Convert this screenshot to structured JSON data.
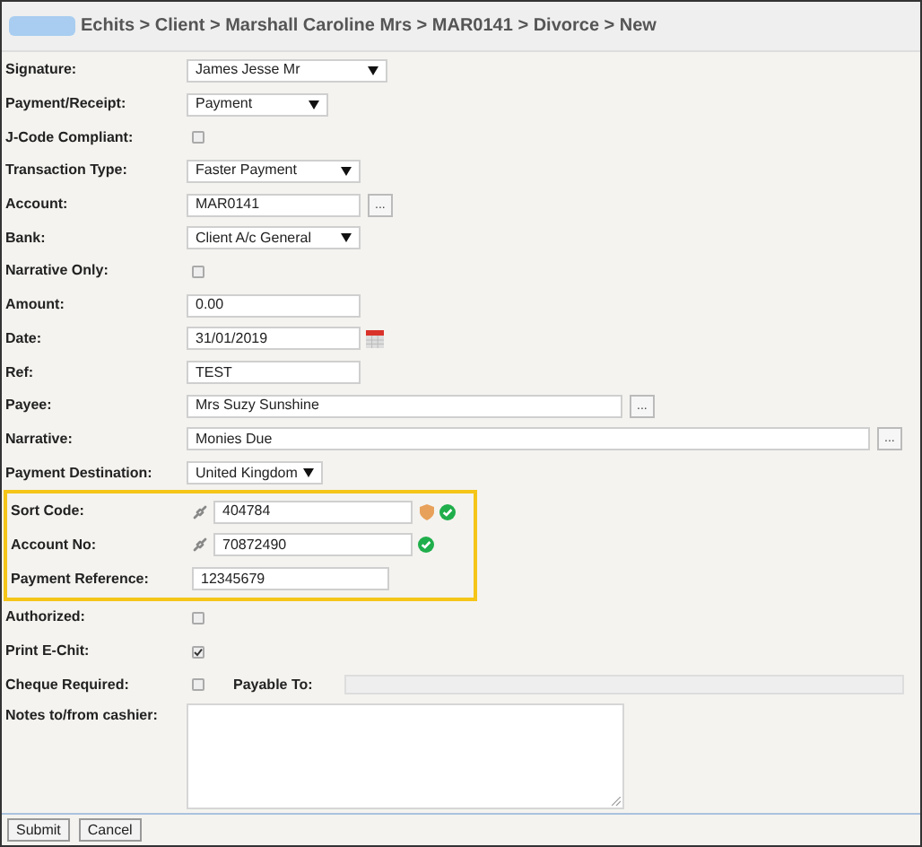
{
  "breadcrumb": "Echits > Client > Marshall Caroline Mrs > MAR0141 > Divorce > New",
  "fields": [
    {
      "label": "Signature:",
      "kind": "select",
      "value": "James Jesse Mr"
    },
    {
      "label": "Payment/Receipt:",
      "kind": "select",
      "value": "Payment"
    },
    {
      "label": "J-Code Compliant:",
      "kind": "checkbox",
      "checked": false
    },
    {
      "label": "Transaction Type:",
      "kind": "select",
      "value": "Faster Payment"
    },
    {
      "label": "Account:",
      "kind": "lookup",
      "value": "MAR0141",
      "button": "..."
    },
    {
      "label": "Bank:",
      "kind": "select",
      "value": "Client A/c General"
    },
    {
      "label": "Narrative Only:",
      "kind": "checkbox",
      "checked": false
    },
    {
      "label": "Amount:",
      "kind": "text",
      "value": "0.00"
    },
    {
      "label": "Date:",
      "kind": "date",
      "value": "31/01/2019"
    },
    {
      "label": "Ref:",
      "kind": "text",
      "value": "TEST"
    },
    {
      "label": "Payee:",
      "kind": "lookup",
      "value": "Mrs Suzy Sunshine",
      "button": "..."
    },
    {
      "label": "Narrative:",
      "kind": "lookup",
      "value": "Monies Due",
      "button": "..."
    },
    {
      "label": "Payment Destination:",
      "kind": "select",
      "value": "United Kingdom"
    }
  ],
  "bank_details": [
    {
      "label": "Sort Code:",
      "kind": "linked",
      "value": "404784",
      "flagged": true,
      "verified": true
    },
    {
      "label": "Account No:",
      "kind": "linked",
      "value": "70872490",
      "flagged": false,
      "verified": true
    },
    {
      "label": "Payment Reference:",
      "kind": "text",
      "value": "12345679"
    }
  ],
  "more_fields": [
    {
      "label": "Authorized:",
      "kind": "checkbox",
      "checked": false
    },
    {
      "label": "Print E-Chit:",
      "kind": "checkbox",
      "checked": true
    },
    {
      "label": "Cheque Required:",
      "kind": "cheque",
      "checked": false,
      "payable_label": "Payable To:"
    },
    {
      "label": "Notes to/from cashier:",
      "kind": "textarea"
    }
  ],
  "buttons": [
    "Submit",
    "Cancel"
  ]
}
